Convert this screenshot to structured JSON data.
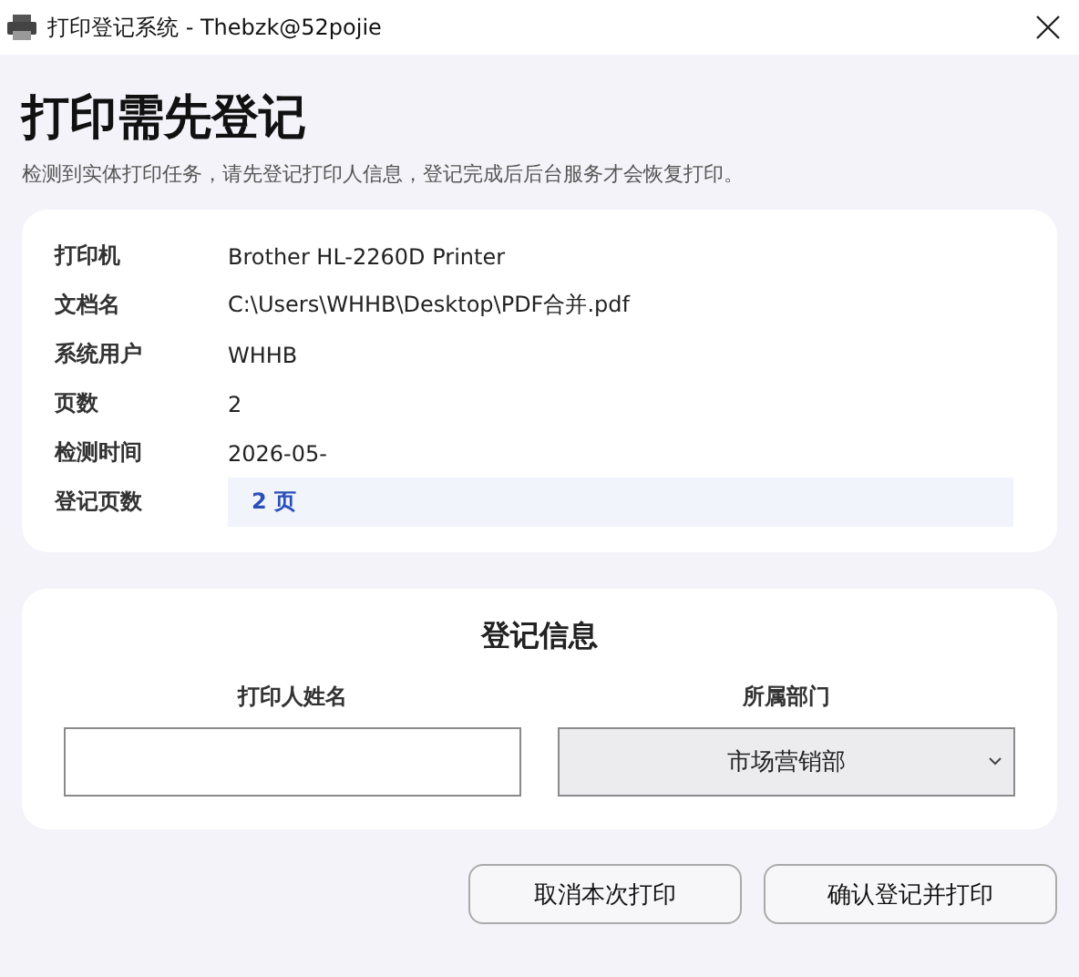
{
  "window": {
    "title": "打印登记系统 - Thebzk@52pojie"
  },
  "heading": "打印需先登记",
  "subtitle": "检测到实体打印任务，请先登记打印人信息，登记完成后后台服务才会恢复打印。",
  "details": [
    {
      "label": "打印机",
      "value": "Brother HL-2260D Printer",
      "kind": "plain"
    },
    {
      "label": "文档名",
      "value": "C:\\Users\\WHHB\\Desktop\\PDF合并.pdf",
      "kind": "plain"
    },
    {
      "label": "系统用户",
      "value": "WHHB",
      "kind": "plain"
    },
    {
      "label": "页数",
      "value": "2",
      "kind": "plain"
    },
    {
      "label": "检测时间",
      "value": "2026-05-",
      "kind": "plain"
    },
    {
      "label": "登记页数",
      "value": "2 页",
      "kind": "highlight"
    }
  ],
  "form": {
    "title": "登记信息",
    "name_field": {
      "label": "打印人姓名"
    },
    "department": {
      "label": "所属部门",
      "value": "市场营销部"
    }
  },
  "buttons": [
    "取消本次打印",
    "确认登记并打印"
  ]
}
